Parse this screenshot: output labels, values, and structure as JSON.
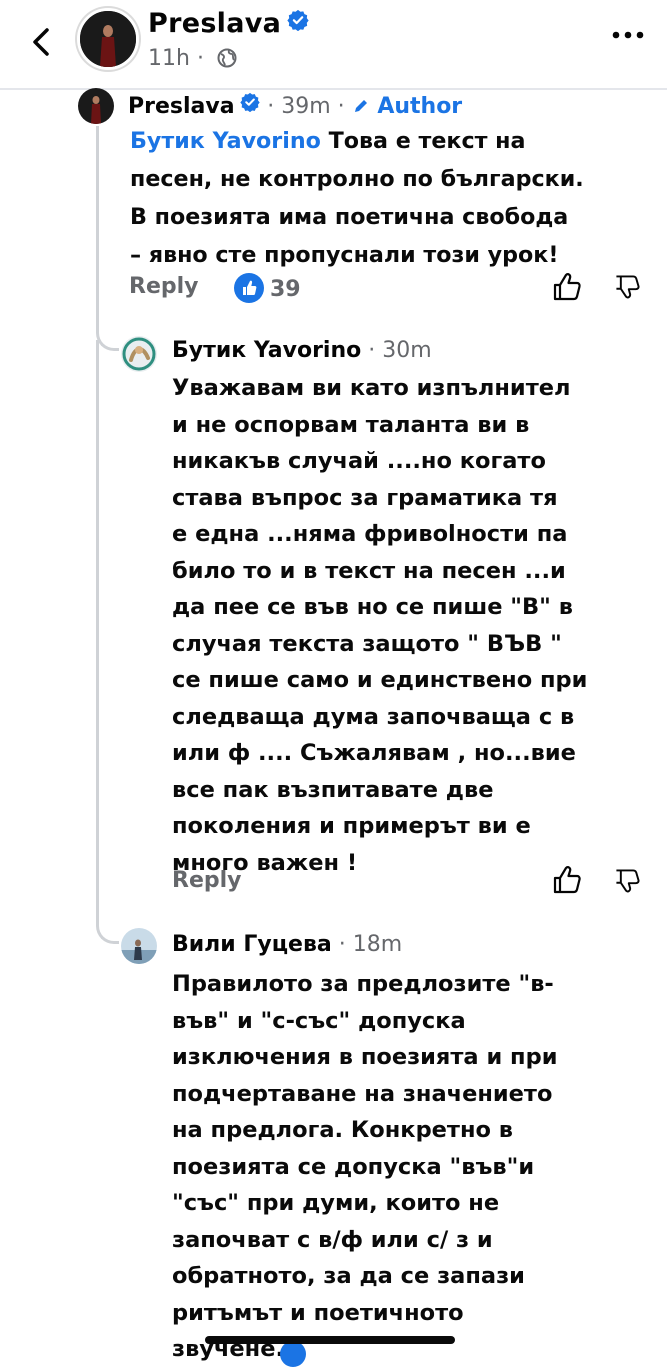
{
  "header": {
    "name": "Preslava",
    "time": "11h"
  },
  "comments": [
    {
      "author": "Preslava",
      "time": "39m",
      "author_badge": "Author",
      "mention": "Бутик Yavorino",
      "text_lines": [
        " Това е текст на",
        "песен, не контролно по български.",
        "В поезията има поетична свобода",
        "– явно сте пропуснали този урок!"
      ],
      "reply_label": "Reply",
      "like_count": "39"
    },
    {
      "author": "Бутик Yavorino",
      "time": "30m",
      "text_lines": [
        "Уважавам ви като изпълнител",
        "и  не оспорвам таланта ви в",
        "никакъв случай ....но когато",
        "става въпрос за граматика тя",
        "е една ...няма фривolности па",
        "било то и в текст на песен ...и",
        "да пее се във но се пише \"В\" в",
        "случая текста защото \" ВЪВ \"",
        "се пише само и единствено при",
        "следваща дума започваща с в",
        "или ф .... Съжалявам , но...вие",
        "все пак възпитавате две",
        "поколения и примерът ви е",
        "много важен !"
      ],
      "reply_label": "Reply"
    },
    {
      "author": "Вили Гуцева",
      "time": "18m",
      "text_lines": [
        "Правилото за предлозите \"в-",
        "във\" и \"с-със\" допуска",
        "изключения в поезията и при",
        "подчертаване на значението",
        "на предлога. Конкретно в",
        "поезията се допуска \"във\"и",
        "\"със\" при думи, които не",
        "започват с в/ф или с/ з и",
        "обратното, за да се запази",
        "ритъмът и поетичното",
        "звучене."
      ]
    }
  ],
  "icons": {
    "back": "chevron-left-icon",
    "verified": "verified-badge-icon",
    "globe": "globe-icon",
    "more": "more-icon",
    "pencil": "pencil-icon",
    "like": "thumbs-up-icon",
    "dislike": "thumbs-down-icon"
  },
  "colors": {
    "accent": "#1b74e4",
    "secondary_text": "#65676b",
    "thread_line": "#cfd2d6"
  }
}
